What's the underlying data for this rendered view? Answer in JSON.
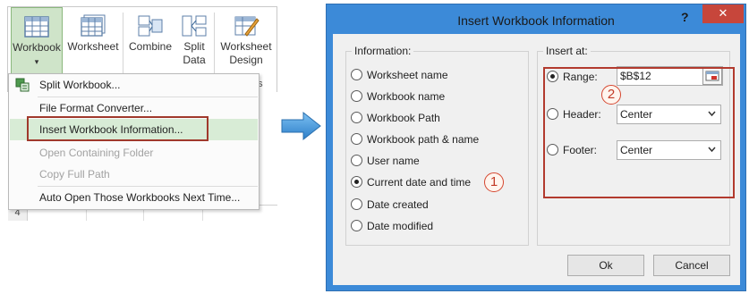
{
  "ribbon": {
    "buttons": [
      {
        "label": "Workbook",
        "caret": "▾",
        "icon": "workbook-grid-icon"
      },
      {
        "label": "Worksheet",
        "icon": "worksheet-grid-icon"
      },
      {
        "label": "Combine",
        "icon": "combine-icon"
      },
      {
        "label": "Split\nData",
        "icon": "split-data-icon"
      },
      {
        "label": "Worksheet\nDesign",
        "icon": "worksheet-design-icon"
      }
    ],
    "group_label_fragment": "ets"
  },
  "menu": {
    "items": [
      {
        "label": "Split Workbook...",
        "enabled": true,
        "icon": "split-workbook-icon"
      },
      {
        "label": "File Format Converter...",
        "enabled": true
      },
      {
        "label": "Insert Workbook Information...",
        "enabled": true,
        "highlighted": true
      },
      {
        "label": "Open Containing Folder",
        "enabled": false
      },
      {
        "label": "Copy Full Path",
        "enabled": false
      },
      {
        "label": "Auto Open Those Workbooks Next Time...",
        "enabled": true
      }
    ]
  },
  "sheet": {
    "row_number": "4"
  },
  "dialog": {
    "title": "Insert Workbook Information",
    "help": "?",
    "close": "✕",
    "information": {
      "group_title": "Information:",
      "options": [
        {
          "label": "Worksheet name",
          "checked": false
        },
        {
          "label": "Workbook name",
          "checked": false
        },
        {
          "label": "Workbook Path",
          "checked": false
        },
        {
          "label": "Workbook path & name",
          "checked": false
        },
        {
          "label": "User name",
          "checked": false
        },
        {
          "label": "Current date and time",
          "checked": true
        },
        {
          "label": "Date created",
          "checked": false
        },
        {
          "label": "Date modified",
          "checked": false
        }
      ]
    },
    "insert_at": {
      "group_title": "Insert at:",
      "range": {
        "label": "Range:",
        "value": "$B$12",
        "checked": true
      },
      "header": {
        "label": "Header:",
        "value": "Center",
        "checked": false
      },
      "footer": {
        "label": "Footer:",
        "value": "Center",
        "checked": false
      }
    },
    "ok_label": "Ok",
    "cancel_label": "Cancel"
  },
  "badges": {
    "one": "1",
    "two": "2"
  },
  "colors": {
    "dialog_frame": "#3c8ad8",
    "close_button": "#c7463b",
    "highlight_box": "#b23a2e",
    "menu_highlight": "#d8ecd6",
    "arrow": "#3d8fd6"
  }
}
